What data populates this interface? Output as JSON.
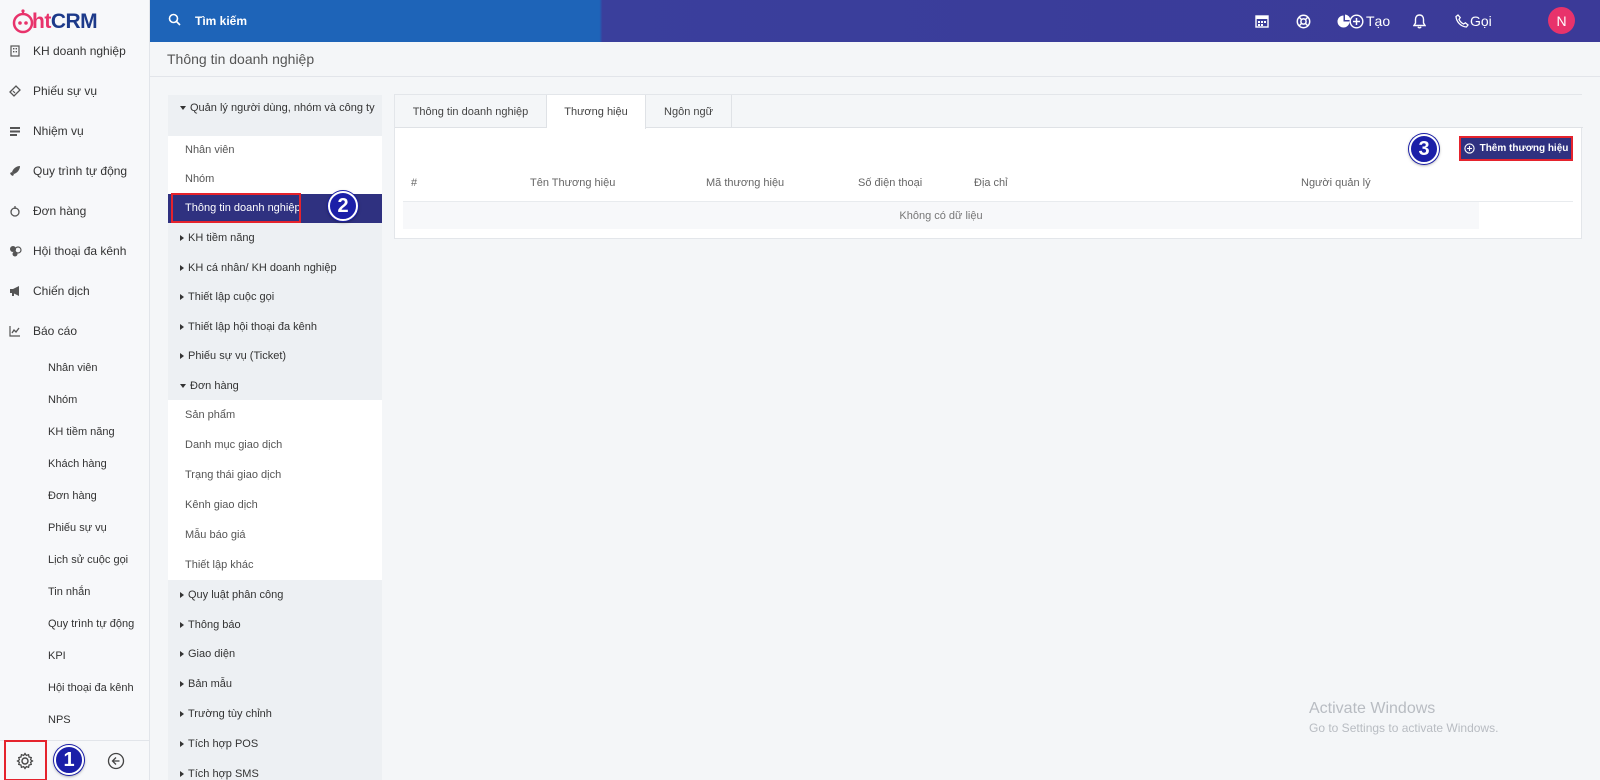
{
  "app": {
    "logo": {
      "prefix": "ht",
      "suffix": "CRM"
    }
  },
  "search": {
    "placeholder": "Tìm kiếm"
  },
  "topbar": {
    "create_label": "Tạo",
    "call_label": "Gọi",
    "avatar_initial": "N"
  },
  "page": {
    "title": "Thông tin doanh nghiệp"
  },
  "sidebar": {
    "items": [
      {
        "label": "KH doanh nghiệp",
        "icon": "building-icon"
      },
      {
        "label": "Phiếu sự vụ",
        "icon": "ticket-icon"
      },
      {
        "label": "Nhiệm vụ",
        "icon": "task-list-icon"
      },
      {
        "label": "Quy trình tự động",
        "icon": "rocket-icon"
      },
      {
        "label": "Đơn hàng",
        "icon": "order-icon"
      },
      {
        "label": "Hội thoại đa kênh",
        "icon": "chat-channels-icon"
      },
      {
        "label": "Chiến dịch",
        "icon": "megaphone-icon"
      },
      {
        "label": "Báo cáo",
        "icon": "report-chart-icon"
      }
    ],
    "report_subitems": [
      "Nhân viên",
      "Nhóm",
      "KH tiềm năng",
      "Khách hàng",
      "Đơn hàng",
      "Phiếu sự vụ",
      "Lịch sử cuộc gọi",
      "Tin nhắn",
      "Quy trình tự động",
      "KPI",
      "Hội thoại đa kênh",
      "NPS"
    ]
  },
  "settings_menu": {
    "user_group": "Quản lý người dùng, nhóm và công ty",
    "user_children": [
      "Nhân viên",
      "Nhóm",
      "Thông tin doanh nghiệp"
    ],
    "groups_a": [
      "KH tiềm năng",
      "KH cá nhân/ KH doanh nghiệp",
      "Thiết lập cuộc gọi",
      "Thiết lập hội thoại đa kênh",
      "Phiếu sự vụ (Ticket)"
    ],
    "order_group": "Đơn hàng",
    "order_children": [
      "Sản phẩm",
      "Danh mục giao dịch",
      "Trạng thái giao dịch",
      "Kênh giao dịch",
      "Mẫu báo giá",
      "Thiết lập khác"
    ],
    "groups_b": [
      "Quy luật phân công",
      "Thông báo",
      "Giao diện",
      "Bản mẫu",
      "Trường tùy chỉnh",
      "Tích hợp POS",
      "Tích hợp SMS"
    ]
  },
  "tabs": [
    "Thông tin doanh nghiệp",
    "Thương hiệu",
    "Ngôn ngữ"
  ],
  "brand_table": {
    "add_button": "Thêm thương hiệu",
    "columns": [
      "#",
      "Tên Thương hiệu",
      "Mã thương hiệu",
      "Số điện thoại",
      "Địa chỉ",
      "Người quản lý"
    ],
    "empty_text": "Không có dữ liệu"
  },
  "steps": [
    "1",
    "2",
    "3"
  ],
  "watermark": {
    "line1": "Activate Windows",
    "line2": "Go to Settings to activate Windows."
  },
  "colors": {
    "primary_blue": "#1e64b8",
    "navy": "#2f3180",
    "brand_pink": "#e8336b",
    "highlight_red": "#e5232d"
  }
}
